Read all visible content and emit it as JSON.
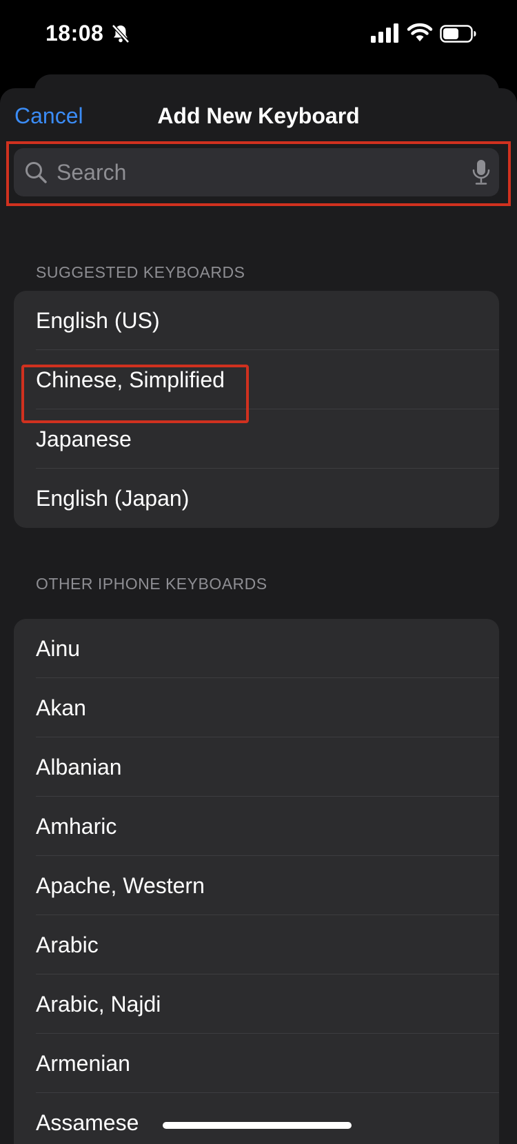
{
  "status_bar": {
    "time": "18:08",
    "icons": [
      "bell-slash-icon",
      "cellular-signal-icon",
      "wifi-icon",
      "battery-icon"
    ]
  },
  "nav": {
    "cancel_label": "Cancel",
    "title": "Add New Keyboard"
  },
  "search": {
    "placeholder": "Search",
    "value": "",
    "icons": [
      "search-icon",
      "microphone-icon"
    ]
  },
  "suggested": {
    "header": "SUGGESTED KEYBOARDS",
    "items": [
      {
        "label": "English (US)"
      },
      {
        "label": "Chinese, Simplified"
      },
      {
        "label": "Japanese"
      },
      {
        "label": "English (Japan)"
      }
    ]
  },
  "other": {
    "header": "OTHER IPHONE KEYBOARDS",
    "items": [
      {
        "label": "Ainu"
      },
      {
        "label": "Akan"
      },
      {
        "label": "Albanian"
      },
      {
        "label": "Amharic"
      },
      {
        "label": "Apache, Western"
      },
      {
        "label": "Arabic"
      },
      {
        "label": "Arabic, Najdi"
      },
      {
        "label": "Armenian"
      },
      {
        "label": "Assamese"
      }
    ]
  },
  "colors": {
    "accent": "#3b8cf6",
    "highlight": "#d0311f",
    "sheet_bg": "#1c1c1e",
    "cell_bg": "#2c2c2e"
  }
}
